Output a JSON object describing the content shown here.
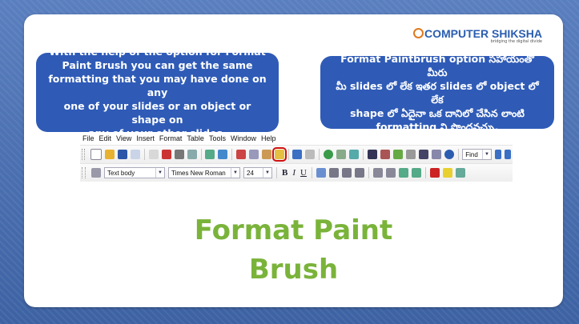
{
  "logo": {
    "text": "COMPUTER SHIKSHA",
    "tagline": "bridging the digital divide"
  },
  "callouts": {
    "english": [
      "With the help of the option for Format",
      "Paint Brush you can get the same",
      "formatting that you may have done on any",
      "one of your slides or an object or shape on",
      "any of your other slides."
    ],
    "telugu": [
      "Format Paintbrush option సహాయంతో మీరు",
      "మీ slides లో లేక ఇతర slides లో object లో లేక",
      "shape లో ఏదైనా ఒక దానిలో చేసిన లాంటి",
      "formatting ని పొందవచ్చు."
    ]
  },
  "menubar": [
    "File",
    "Edit",
    "View",
    "Insert",
    "Format",
    "Table",
    "Tools",
    "Window",
    "Help"
  ],
  "toolbar": {
    "find_placeholder": "Find",
    "style_value": "Text body",
    "font_value": "Times New Roman",
    "size_value": "24",
    "bold": "B",
    "italic": "I",
    "underline": "U"
  },
  "title": [
    "Format Paint",
    "Brush"
  ],
  "colors": {
    "callout": "#2f5bb7",
    "title": "#7ab33a",
    "highlight": "#d01010",
    "background": "#4a6fae"
  }
}
